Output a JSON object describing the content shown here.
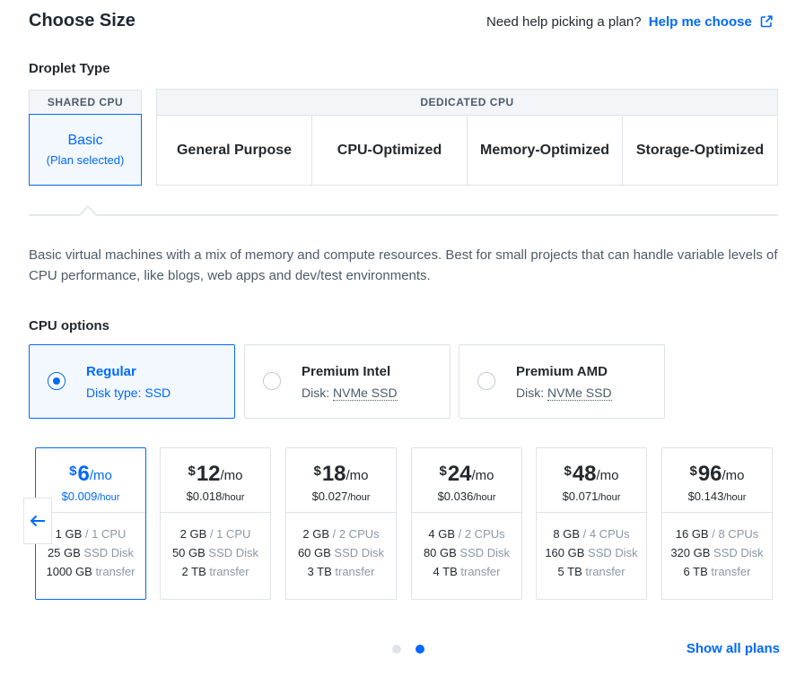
{
  "header": {
    "title": "Choose Size",
    "help_text": "Need help picking a plan?",
    "help_link": "Help me choose"
  },
  "droplet_type": {
    "label": "Droplet Type",
    "shared_header": "SHARED CPU",
    "dedicated_header": "DEDICATED CPU",
    "basic_label": "Basic",
    "basic_selected": "(Plan selected)",
    "dedicated_items": [
      {
        "label": "General Purpose"
      },
      {
        "label": "CPU-Optimized"
      },
      {
        "label": "Memory-Optimized"
      },
      {
        "label": "Storage-Optimized"
      }
    ]
  },
  "description": "Basic virtual machines with a mix of memory and compute resources. Best for small projects that can handle variable levels of CPU performance, like blogs, web apps and dev/test environments.",
  "cpu_options": {
    "label": "CPU options",
    "items": [
      {
        "title": "Regular",
        "disk_label": "Disk type:",
        "disk_value": "SSD",
        "selected": true
      },
      {
        "title": "Premium Intel",
        "disk_label": "Disk:",
        "disk_value": "NVMe SSD",
        "selected": false
      },
      {
        "title": "Premium AMD",
        "disk_label": "Disk:",
        "disk_value": "NVMe SSD",
        "selected": false
      }
    ]
  },
  "plans": [
    {
      "currency": "$",
      "price": "6",
      "per": "/mo",
      "hourly": "$0.009",
      "hour_unit": "/hour",
      "ram": "1 GB",
      "cpu": "/ 1 CPU",
      "disk": "25 GB",
      "disk_type": "SSD Disk",
      "transfer": "1000 GB",
      "transfer_label": "transfer",
      "selected": true
    },
    {
      "currency": "$",
      "price": "12",
      "per": "/mo",
      "hourly": "$0.018",
      "hour_unit": "/hour",
      "ram": "2 GB",
      "cpu": "/ 1 CPU",
      "disk": "50 GB",
      "disk_type": "SSD Disk",
      "transfer": "2 TB",
      "transfer_label": "transfer",
      "selected": false
    },
    {
      "currency": "$",
      "price": "18",
      "per": "/mo",
      "hourly": "$0.027",
      "hour_unit": "/hour",
      "ram": "2 GB",
      "cpu": "/ 2 CPUs",
      "disk": "60 GB",
      "disk_type": "SSD Disk",
      "transfer": "3 TB",
      "transfer_label": "transfer",
      "selected": false
    },
    {
      "currency": "$",
      "price": "24",
      "per": "/mo",
      "hourly": "$0.036",
      "hour_unit": "/hour",
      "ram": "4 GB",
      "cpu": "/ 2 CPUs",
      "disk": "80 GB",
      "disk_type": "SSD Disk",
      "transfer": "4 TB",
      "transfer_label": "transfer",
      "selected": false
    },
    {
      "currency": "$",
      "price": "48",
      "per": "/mo",
      "hourly": "$0.071",
      "hour_unit": "/hour",
      "ram": "8 GB",
      "cpu": "/ 4 CPUs",
      "disk": "160 GB",
      "disk_type": "SSD Disk",
      "transfer": "5 TB",
      "transfer_label": "transfer",
      "selected": false
    },
    {
      "currency": "$",
      "price": "96",
      "per": "/mo",
      "hourly": "$0.143",
      "hour_unit": "/hour",
      "ram": "16 GB",
      "cpu": "/ 8 CPUs",
      "disk": "320 GB",
      "disk_type": "SSD Disk",
      "transfer": "6 TB",
      "transfer_label": "transfer",
      "selected": false
    }
  ],
  "pagination": {
    "pages": 2,
    "current": 2,
    "active_color": "#0069ff",
    "inactive_color": "#dfe3e8"
  },
  "show_all": "Show all plans",
  "colors": {
    "accent": "#0069ff",
    "border": "#dfe3e8",
    "muted": "#8b97a5"
  },
  "icons": {
    "external_link": "external-link-icon",
    "prev": "arrow-left-icon"
  }
}
